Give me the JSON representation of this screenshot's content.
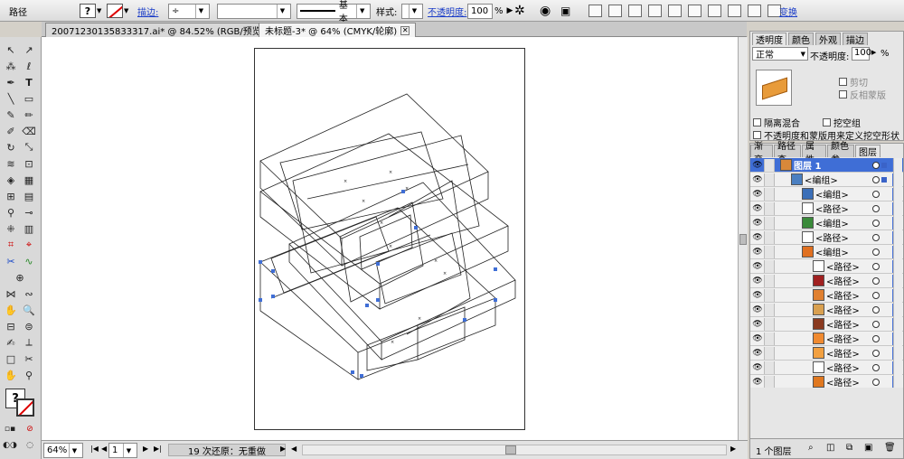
{
  "control_bar": {
    "object_type": "路径",
    "stroke_label": "描边:",
    "stroke_profile": "基本",
    "style_label": "样式:",
    "opacity_label": "不透明度:",
    "opacity_value": "100",
    "opacity_unit": "%",
    "transform_label": "变换"
  },
  "doc_tabs": [
    {
      "label": "20071230135833317.ai* @ 84.52% (RGB/预览)"
    },
    {
      "label": "未标题-3* @ 64% (CMYK/轮廓)"
    }
  ],
  "tab_close_glyph": "✕",
  "status_bar": {
    "zoom": "64%",
    "page": "1",
    "status_text": "19 次还原：无重做"
  },
  "transparency_panel": {
    "tabs": [
      "透明度",
      "颜色",
      "外观",
      "描边"
    ],
    "blend_mode": "正常",
    "opacity_label": "不透明度:",
    "opacity_value": "100",
    "opacity_unit": "%",
    "clip_label": "剪切",
    "invert_mask_label": "反相蒙版",
    "isolate_blend_label": "隔离混合",
    "knockout_group_label": "挖空组",
    "opacity_mask_label": "不透明度和蒙版用来定义挖空形状"
  },
  "layers_panel": {
    "tabs": [
      "渐变",
      "路径查",
      "属性",
      "颜色参",
      "图层"
    ],
    "rows": [
      {
        "label": "图层 1",
        "indent": 0,
        "selected": true,
        "swatch": "#d8883a"
      },
      {
        "label": "<编组>",
        "indent": 1,
        "selected": false,
        "swatch": "#4a7fc1"
      },
      {
        "label": "<编组>",
        "indent": 2,
        "selected": false,
        "swatch": "#3b6fb8"
      },
      {
        "label": "<路径>",
        "indent": 2,
        "selected": false,
        "swatch": "#ffffff"
      },
      {
        "label": "<编组>",
        "indent": 2,
        "selected": false,
        "swatch": "#3a8a3a"
      },
      {
        "label": "<路径>",
        "indent": 2,
        "selected": false,
        "swatch": "#ffffff"
      },
      {
        "label": "<编组>",
        "indent": 2,
        "selected": false,
        "swatch": "#e07020"
      },
      {
        "label": "<路径>",
        "indent": 3,
        "selected": false,
        "swatch": "#ffffff"
      },
      {
        "label": "<路径>",
        "indent": 3,
        "selected": false,
        "swatch": "#a02020"
      },
      {
        "label": "<路径>",
        "indent": 3,
        "selected": false,
        "swatch": "#e08030"
      },
      {
        "label": "<路径>",
        "indent": 3,
        "selected": false,
        "swatch": "#d9a050"
      },
      {
        "label": "<路径>",
        "indent": 3,
        "selected": false,
        "swatch": "#8a3a20"
      },
      {
        "label": "<路径>",
        "indent": 3,
        "selected": false,
        "swatch": "#f08a30"
      },
      {
        "label": "<路径>",
        "indent": 3,
        "selected": false,
        "swatch": "#f2a040"
      },
      {
        "label": "<路径>",
        "indent": 3,
        "selected": false,
        "swatch": "#ffffff"
      },
      {
        "label": "<路径>",
        "indent": 3,
        "selected": false,
        "swatch": "#e07820"
      }
    ],
    "footer_count": "1 个图层"
  },
  "colors": {
    "selection_blue": "#3f6ed6",
    "accent_link": "#1a3cc8"
  }
}
